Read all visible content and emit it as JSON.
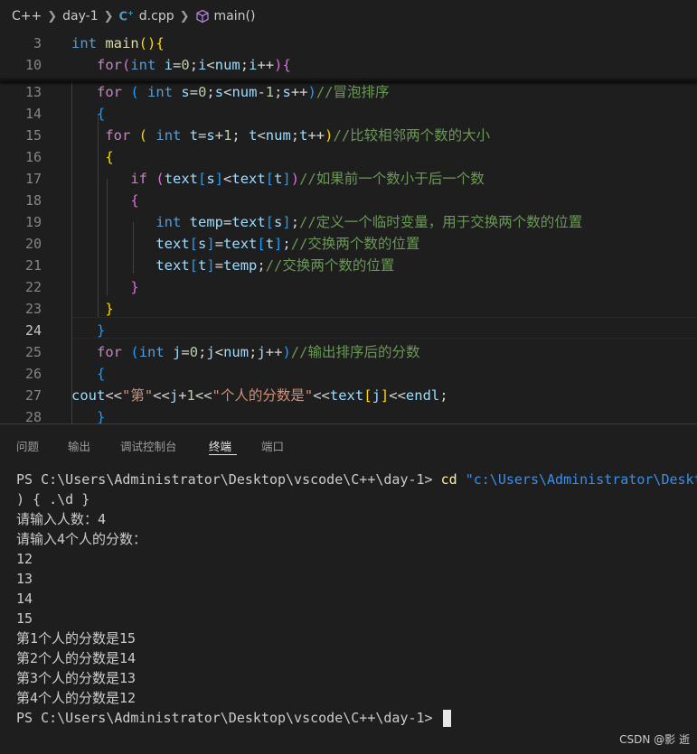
{
  "breadcrumb": {
    "items": [
      "C++",
      "day-1",
      "d.cpp",
      "main()"
    ],
    "file_icon": "C",
    "icons": [
      "chevron-right-icon",
      "cpp-file-icon",
      "cube-method-icon"
    ]
  },
  "editor": {
    "active_line": "24",
    "lines": [
      {
        "n": "3",
        "tokens": [
          {
            "t": "int",
            "c": "kw"
          },
          {
            "t": " ",
            "c": "pl"
          },
          {
            "t": "main",
            "c": "fn"
          },
          {
            "t": "()",
            "c": "b1"
          },
          {
            "t": "{",
            "c": "b1"
          }
        ]
      },
      {
        "n": "10",
        "tokens": [
          {
            "t": "   ",
            "c": "pl"
          },
          {
            "t": "for",
            "c": "ctl"
          },
          {
            "t": "(",
            "c": "b2"
          },
          {
            "t": "int",
            "c": "kw"
          },
          {
            "t": " ",
            "c": "pl"
          },
          {
            "t": "i",
            "c": "var"
          },
          {
            "t": "=",
            "c": "pl"
          },
          {
            "t": "0",
            "c": "num"
          },
          {
            "t": ";",
            "c": "pl"
          },
          {
            "t": "i",
            "c": "var"
          },
          {
            "t": "<",
            "c": "pl"
          },
          {
            "t": "num",
            "c": "var"
          },
          {
            "t": ";",
            "c": "pl"
          },
          {
            "t": "i",
            "c": "var"
          },
          {
            "t": "++",
            "c": "pl"
          },
          {
            "t": ")",
            "c": "b2"
          },
          {
            "t": "{",
            "c": "b2"
          }
        ]
      },
      {
        "n": "13",
        "tokens": [
          {
            "t": "   ",
            "c": "pl"
          },
          {
            "t": "for",
            "c": "ctl"
          },
          {
            "t": " ",
            "c": "pl"
          },
          {
            "t": "(",
            "c": "b3"
          },
          {
            "t": " ",
            "c": "pl"
          },
          {
            "t": "int",
            "c": "kw"
          },
          {
            "t": " ",
            "c": "pl"
          },
          {
            "t": "s",
            "c": "var"
          },
          {
            "t": "=",
            "c": "pl"
          },
          {
            "t": "0",
            "c": "num"
          },
          {
            "t": ";",
            "c": "pl"
          },
          {
            "t": "s",
            "c": "var"
          },
          {
            "t": "<",
            "c": "pl"
          },
          {
            "t": "num",
            "c": "var"
          },
          {
            "t": "-",
            "c": "pl"
          },
          {
            "t": "1",
            "c": "num"
          },
          {
            "t": ";",
            "c": "pl"
          },
          {
            "t": "s",
            "c": "var"
          },
          {
            "t": "++",
            "c": "pl"
          },
          {
            "t": ")",
            "c": "b3"
          },
          {
            "t": "//冒泡排序",
            "c": "cmt"
          }
        ]
      },
      {
        "n": "14",
        "tokens": [
          {
            "t": "   ",
            "c": "pl"
          },
          {
            "t": "{",
            "c": "b3"
          }
        ]
      },
      {
        "n": "15",
        "tokens": [
          {
            "t": "    ",
            "c": "pl"
          },
          {
            "t": "for",
            "c": "ctl"
          },
          {
            "t": " ",
            "c": "pl"
          },
          {
            "t": "(",
            "c": "b1"
          },
          {
            "t": " ",
            "c": "pl"
          },
          {
            "t": "int",
            "c": "kw"
          },
          {
            "t": " ",
            "c": "pl"
          },
          {
            "t": "t",
            "c": "var"
          },
          {
            "t": "=",
            "c": "pl"
          },
          {
            "t": "s",
            "c": "var"
          },
          {
            "t": "+",
            "c": "pl"
          },
          {
            "t": "1",
            "c": "num"
          },
          {
            "t": "; ",
            "c": "pl"
          },
          {
            "t": "t",
            "c": "var"
          },
          {
            "t": "<",
            "c": "pl"
          },
          {
            "t": "num",
            "c": "var"
          },
          {
            "t": ";",
            "c": "pl"
          },
          {
            "t": "t",
            "c": "var"
          },
          {
            "t": "++",
            "c": "pl"
          },
          {
            "t": ")",
            "c": "b1"
          },
          {
            "t": "//比较相邻两个数的大小",
            "c": "cmt"
          }
        ]
      },
      {
        "n": "16",
        "tokens": [
          {
            "t": "    ",
            "c": "pl"
          },
          {
            "t": "{",
            "c": "b1"
          }
        ]
      },
      {
        "n": "17",
        "tokens": [
          {
            "t": "       ",
            "c": "pl"
          },
          {
            "t": "if",
            "c": "ctl"
          },
          {
            "t": " ",
            "c": "pl"
          },
          {
            "t": "(",
            "c": "b2"
          },
          {
            "t": "text",
            "c": "var"
          },
          {
            "t": "[",
            "c": "b3"
          },
          {
            "t": "s",
            "c": "var"
          },
          {
            "t": "]",
            "c": "b3"
          },
          {
            "t": "<",
            "c": "pl"
          },
          {
            "t": "text",
            "c": "var"
          },
          {
            "t": "[",
            "c": "b3"
          },
          {
            "t": "t",
            "c": "var"
          },
          {
            "t": "]",
            "c": "b3"
          },
          {
            "t": ")",
            "c": "b2"
          },
          {
            "t": "//如果前一个数小于后一个数",
            "c": "cmt"
          }
        ]
      },
      {
        "n": "18",
        "tokens": [
          {
            "t": "       ",
            "c": "pl"
          },
          {
            "t": "{",
            "c": "b2"
          }
        ]
      },
      {
        "n": "19",
        "tokens": [
          {
            "t": "          ",
            "c": "pl"
          },
          {
            "t": "int",
            "c": "kw"
          },
          {
            "t": " ",
            "c": "pl"
          },
          {
            "t": "temp",
            "c": "var"
          },
          {
            "t": "=",
            "c": "pl"
          },
          {
            "t": "text",
            "c": "var"
          },
          {
            "t": "[",
            "c": "b3"
          },
          {
            "t": "s",
            "c": "var"
          },
          {
            "t": "]",
            "c": "b3"
          },
          {
            "t": ";",
            "c": "pl"
          },
          {
            "t": "//定义一个临时变量，用于交换两个数的位置",
            "c": "cmt"
          }
        ]
      },
      {
        "n": "20",
        "tokens": [
          {
            "t": "          ",
            "c": "pl"
          },
          {
            "t": "text",
            "c": "var"
          },
          {
            "t": "[",
            "c": "b3"
          },
          {
            "t": "s",
            "c": "var"
          },
          {
            "t": "]",
            "c": "b3"
          },
          {
            "t": "=",
            "c": "pl"
          },
          {
            "t": "text",
            "c": "var"
          },
          {
            "t": "[",
            "c": "b3"
          },
          {
            "t": "t",
            "c": "var"
          },
          {
            "t": "]",
            "c": "b3"
          },
          {
            "t": ";",
            "c": "pl"
          },
          {
            "t": "//交换两个数的位置",
            "c": "cmt"
          }
        ]
      },
      {
        "n": "21",
        "tokens": [
          {
            "t": "          ",
            "c": "pl"
          },
          {
            "t": "text",
            "c": "var"
          },
          {
            "t": "[",
            "c": "b3"
          },
          {
            "t": "t",
            "c": "var"
          },
          {
            "t": "]",
            "c": "b3"
          },
          {
            "t": "=",
            "c": "pl"
          },
          {
            "t": "temp",
            "c": "var"
          },
          {
            "t": ";",
            "c": "pl"
          },
          {
            "t": "//交换两个数的位置",
            "c": "cmt"
          }
        ]
      },
      {
        "n": "22",
        "tokens": [
          {
            "t": "       ",
            "c": "pl"
          },
          {
            "t": "}",
            "c": "b2"
          }
        ]
      },
      {
        "n": "23",
        "tokens": [
          {
            "t": "    ",
            "c": "pl"
          },
          {
            "t": "}",
            "c": "b1"
          }
        ]
      },
      {
        "n": "24",
        "tokens": [
          {
            "t": "   ",
            "c": "pl"
          },
          {
            "t": "}",
            "c": "b3"
          }
        ]
      },
      {
        "n": "25",
        "tokens": [
          {
            "t": "   ",
            "c": "pl"
          },
          {
            "t": "for",
            "c": "ctl"
          },
          {
            "t": " ",
            "c": "pl"
          },
          {
            "t": "(",
            "c": "b3"
          },
          {
            "t": "int",
            "c": "kw"
          },
          {
            "t": " ",
            "c": "pl"
          },
          {
            "t": "j",
            "c": "var"
          },
          {
            "t": "=",
            "c": "pl"
          },
          {
            "t": "0",
            "c": "num"
          },
          {
            "t": ";",
            "c": "pl"
          },
          {
            "t": "j",
            "c": "var"
          },
          {
            "t": "<",
            "c": "pl"
          },
          {
            "t": "num",
            "c": "var"
          },
          {
            "t": ";",
            "c": "pl"
          },
          {
            "t": "j",
            "c": "var"
          },
          {
            "t": "++",
            "c": "pl"
          },
          {
            "t": ")",
            "c": "b3"
          },
          {
            "t": "//输出排序后的分数",
            "c": "cmt"
          }
        ]
      },
      {
        "n": "26",
        "tokens": [
          {
            "t": "   ",
            "c": "pl"
          },
          {
            "t": "{",
            "c": "b3"
          }
        ]
      },
      {
        "n": "27",
        "tokens": [
          {
            "t": "cout",
            "c": "var"
          },
          {
            "t": "<<",
            "c": "pl"
          },
          {
            "t": "\"第\"",
            "c": "str"
          },
          {
            "t": "<<",
            "c": "pl"
          },
          {
            "t": "j",
            "c": "var"
          },
          {
            "t": "+",
            "c": "pl"
          },
          {
            "t": "1",
            "c": "num"
          },
          {
            "t": "<<",
            "c": "pl"
          },
          {
            "t": "\"个人的分数是\"",
            "c": "str"
          },
          {
            "t": "<<",
            "c": "pl"
          },
          {
            "t": "text",
            "c": "var"
          },
          {
            "t": "[",
            "c": "b1"
          },
          {
            "t": "j",
            "c": "var"
          },
          {
            "t": "]",
            "c": "b1"
          },
          {
            "t": "<<",
            "c": "pl"
          },
          {
            "t": "endl",
            "c": "var"
          },
          {
            "t": ";",
            "c": "pl"
          }
        ]
      },
      {
        "n": "28",
        "tokens": [
          {
            "t": "   ",
            "c": "pl"
          },
          {
            "t": "}",
            "c": "b3"
          }
        ]
      }
    ]
  },
  "panel": {
    "tabs": [
      "问题",
      "输出",
      "调试控制台",
      "终端",
      "端口"
    ],
    "active_tab": "终端",
    "terminal": {
      "prompt": "PS C:\\Users\\Administrator\\Desktop\\vscode\\C++\\day-1> ",
      "command_kw": "cd",
      "command_path": "\"c:\\Users\\Administrator\\Deskt",
      "line2": ") { .\\d }",
      "output": [
        "请输入人数：4",
        "请输入4个人的分数：",
        "12",
        "13",
        "14",
        "15",
        "第1个人的分数是15",
        "第2个人的分数是14",
        "第3个人的分数是13",
        "第4个人的分数是12"
      ]
    }
  },
  "watermark": "CSDN @影 逝"
}
